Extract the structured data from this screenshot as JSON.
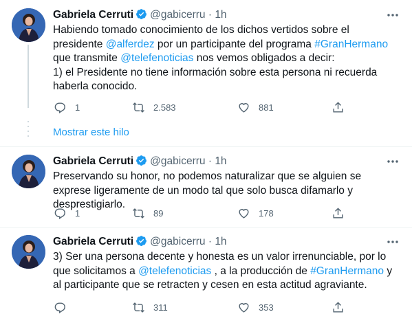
{
  "tweets": [
    {
      "author": "Gabriela Cerruti",
      "handle": "@gabicerru",
      "dot": "·",
      "time": "1h",
      "text_parts": [
        {
          "t": "Habiendo tomado conocimiento de los dichos vertidos sobre el presidente ",
          "link": false
        },
        {
          "t": "@alferdez",
          "link": true
        },
        {
          "t": "  por un participante del programa ",
          "link": false
        },
        {
          "t": "#GranHermano",
          "link": true
        },
        {
          "t": " que transmite ",
          "link": false
        },
        {
          "t": "@telefenoticias",
          "link": true
        },
        {
          "t": " nos vemos obligados a decir:",
          "link": false
        },
        {
          "t": "\n1) el Presidente no tiene información sobre esta persona ni recuerda haberla conocido.",
          "link": false
        }
      ],
      "replies": "1",
      "retweets": "2.583",
      "likes": "881"
    },
    {
      "author": "Gabriela Cerruti",
      "handle": "@gabicerru",
      "dot": "·",
      "time": "1h",
      "text_parts": [
        {
          "t": "Preservando su honor, no podemos naturalizar que se alguien se exprese ligeramente de un modo tal que solo busca difamarlo y desprestigiarlo.",
          "link": false
        }
      ],
      "replies": "1",
      "retweets": "89",
      "likes": "178"
    },
    {
      "author": "Gabriela Cerruti",
      "handle": "@gabicerru",
      "dot": "·",
      "time": "1h",
      "text_parts": [
        {
          "t": "3) Ser una persona decente y honesta es un valor irrenunciable, por lo que solicitamos a ",
          "link": false
        },
        {
          "t": "@telefenoticias",
          "link": true
        },
        {
          "t": " , a la producción de ",
          "link": false
        },
        {
          "t": "#GranHermano",
          "link": true
        },
        {
          "t": " y al participante que se retracten y cesen en esta actitud agraviante.",
          "link": false
        }
      ],
      "replies": "",
      "retweets": "311",
      "likes": "353"
    }
  ],
  "show_thread_label": "Mostrar este hilo",
  "colors": {
    "link": "#1d9bf0",
    "secondary": "#536471",
    "verified": "#1d9bf0"
  }
}
